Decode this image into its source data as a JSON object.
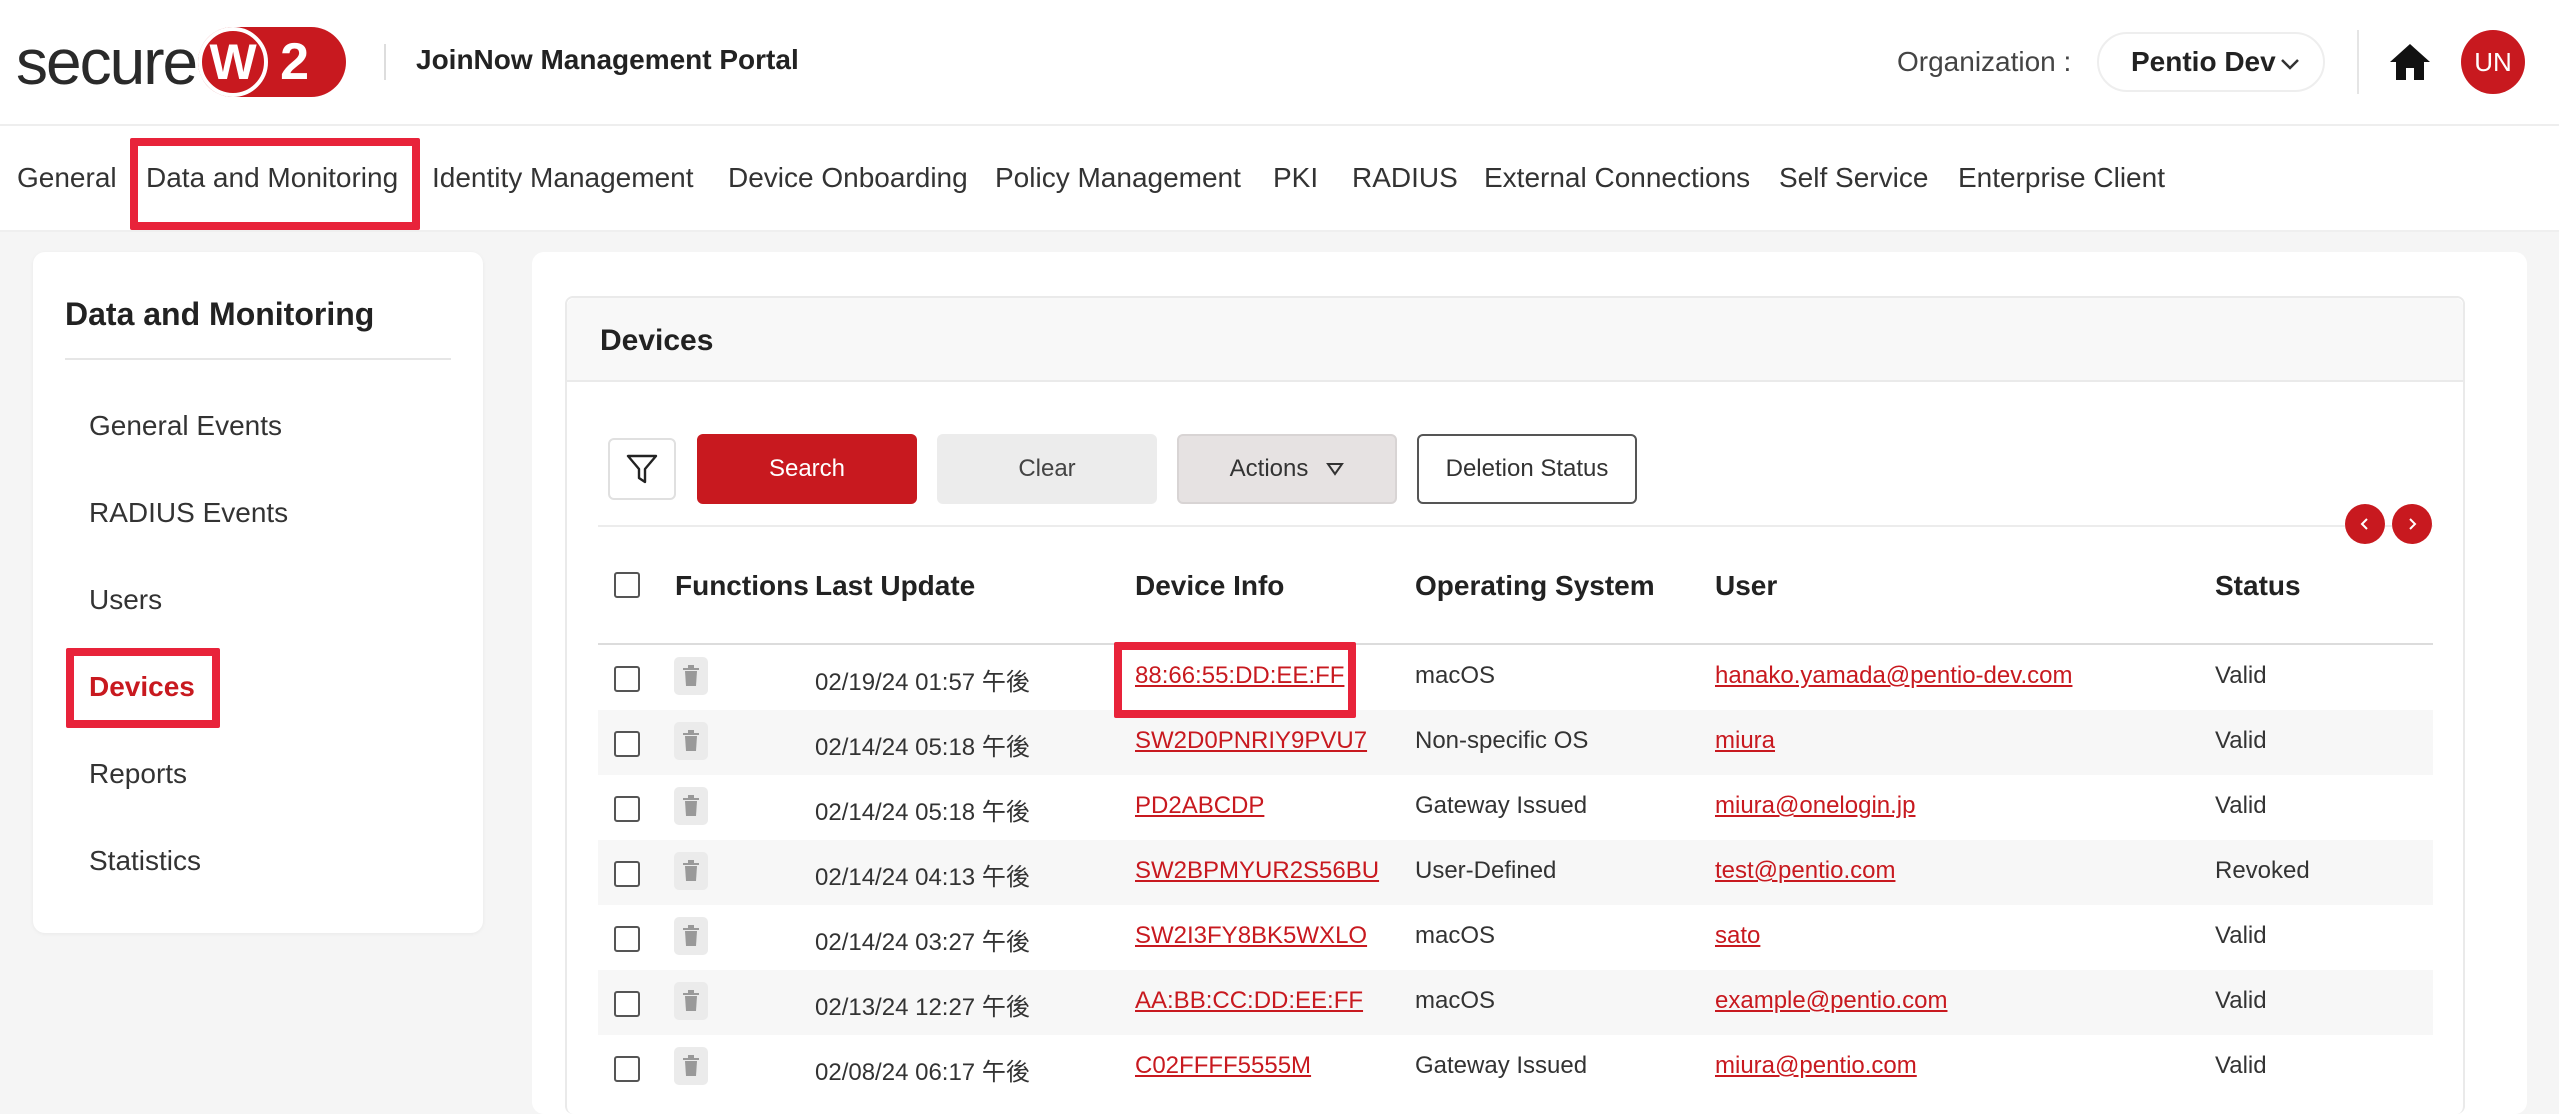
{
  "header": {
    "logo_text": "secure",
    "logo_w": "W",
    "logo_two": "2",
    "portal_title": "JoinNow Management Portal",
    "org_label": "Organization :",
    "org_value": "Pentio Dev",
    "avatar_initials": "UN"
  },
  "nav": {
    "items": [
      "General",
      "Data and Monitoring",
      "Identity Management",
      "Device Onboarding",
      "Policy Management",
      "PKI",
      "RADIUS",
      "External Connections",
      "Self Service",
      "Enterprise Client"
    ]
  },
  "sidebar": {
    "title": "Data and Monitoring",
    "items": [
      "General Events",
      "RADIUS Events",
      "Users",
      "Devices",
      "Reports",
      "Statistics"
    ],
    "active": "Devices"
  },
  "devices": {
    "title": "Devices",
    "buttons": {
      "search": "Search",
      "clear": "Clear",
      "actions": "Actions",
      "deletion_status": "Deletion Status"
    },
    "columns": [
      "Functions",
      "Last Update",
      "Device Info",
      "Operating System",
      "User",
      "Status"
    ],
    "rows": [
      {
        "last_update": "02/19/24 01:57 午後",
        "device_info": "88:66:55:DD:EE:FF",
        "os": "macOS",
        "user": "hanako.yamada@pentio-dev.com",
        "status": "Valid"
      },
      {
        "last_update": "02/14/24 05:18 午後",
        "device_info": "SW2D0PNRIY9PVU7",
        "os": "Non-specific OS",
        "user": "miura",
        "status": "Valid"
      },
      {
        "last_update": "02/14/24 05:18 午後",
        "device_info": "PD2ABCDP",
        "os": "Gateway Issued",
        "user": "miura@onelogin.jp",
        "status": "Valid"
      },
      {
        "last_update": "02/14/24 04:13 午後",
        "device_info": "SW2BPMYUR2S56BU",
        "os": "User-Defined",
        "user": "test@pentio.com",
        "status": "Revoked"
      },
      {
        "last_update": "02/14/24 03:27 午後",
        "device_info": "SW2I3FY8BK5WXLO",
        "os": "macOS",
        "user": "sato",
        "status": "Valid"
      },
      {
        "last_update": "02/13/24 12:27 午後",
        "device_info": "AA:BB:CC:DD:EE:FF",
        "os": "macOS",
        "user": "example@pentio.com",
        "status": "Valid"
      },
      {
        "last_update": "02/08/24 06:17 午後",
        "device_info": "C02FFFF5555M",
        "os": "Gateway Issued",
        "user": "miura@pentio.com",
        "status": "Valid"
      }
    ]
  },
  "colors": {
    "brand_red": "#c8191f",
    "highlight": "#e8233a"
  },
  "icons": [
    "home-icon",
    "chevron-down-icon",
    "filter-icon",
    "triangle-down-icon",
    "chevron-left-icon",
    "chevron-right-icon",
    "trash-icon"
  ]
}
